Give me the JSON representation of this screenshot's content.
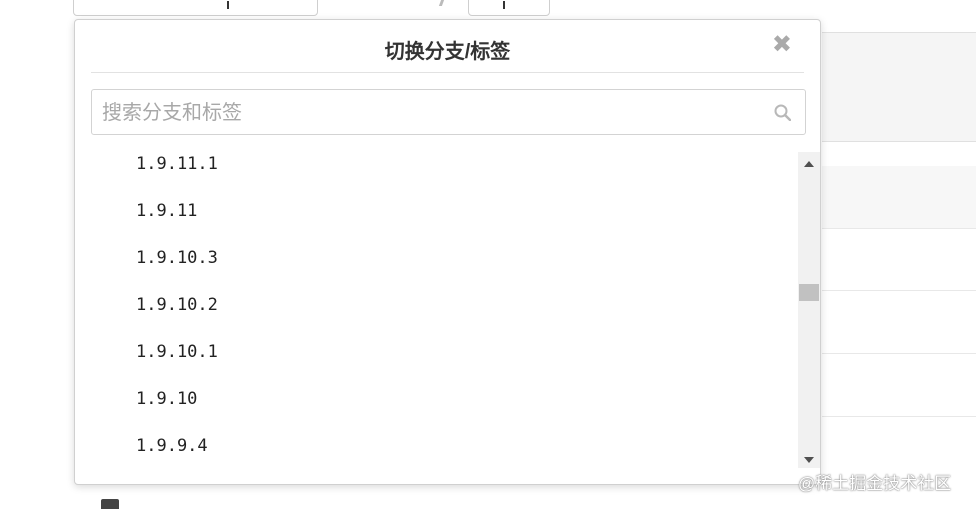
{
  "dropdown": {
    "title": "切换分支/标签",
    "close_glyph": "✖",
    "search": {
      "placeholder": "搜索分支和标签",
      "value": ""
    },
    "items": [
      "1.9.11.1",
      "1.9.11",
      "1.9.10.3",
      "1.9.10.2",
      "1.9.10.1",
      "1.9.10",
      "1.9.9.4"
    ]
  },
  "watermark": "@稀土掘金技术社区",
  "colors": {
    "border": "#d0d0d0",
    "placeholder": "#a8a8a8",
    "scrollbar_track": "#f1f1f1",
    "scrollbar_thumb": "#c1c1c1"
  }
}
